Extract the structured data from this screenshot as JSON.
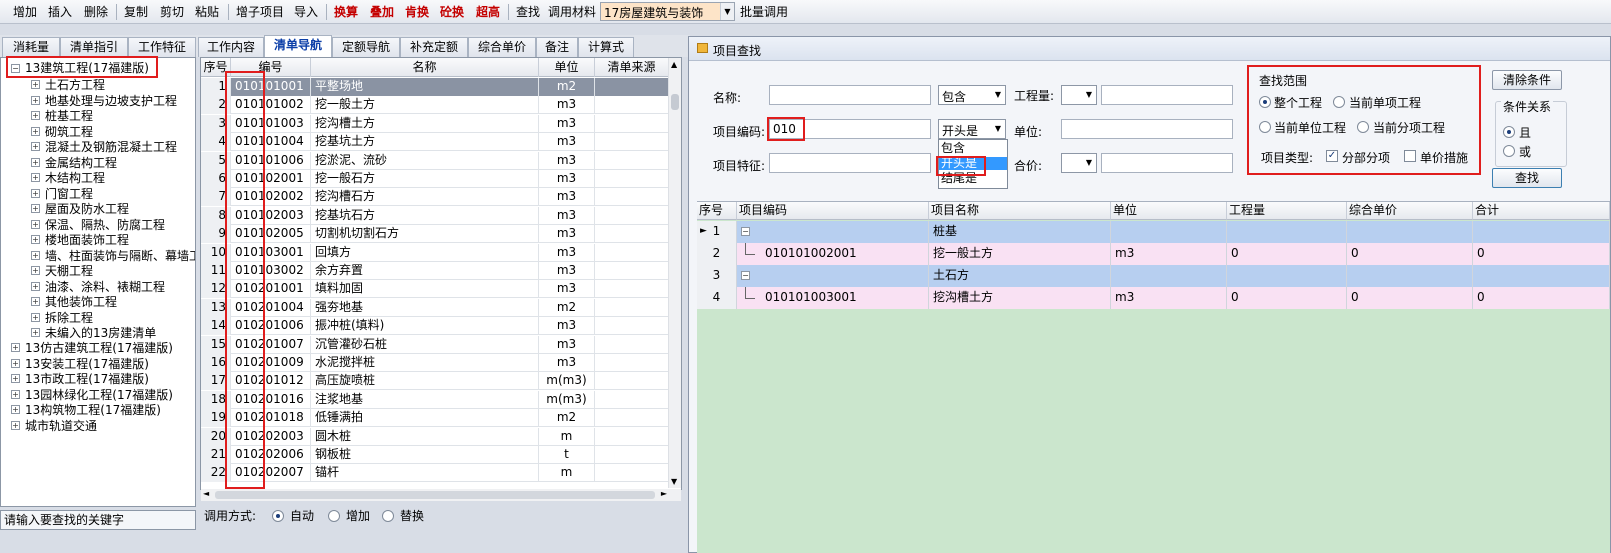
{
  "toolbar": {
    "items": [
      "增加",
      "插入",
      "删除",
      "复制",
      "剪切",
      "粘贴",
      "增子项目",
      "导入",
      "换算",
      "叠加",
      "肯换",
      "砼换",
      "超高",
      "查找",
      "调用材料",
      "批量调用"
    ],
    "combo_value": "17房屋建筑与装饰"
  },
  "tabs": [
    "消耗量",
    "清单指引",
    "工作特征",
    "工作内容",
    "清单导航",
    "定额导航",
    "补充定额",
    "综合单价",
    "备注",
    "计算式"
  ],
  "tree": {
    "root": "13建筑工程(17福建版)",
    "children": [
      "土石方工程",
      "地基处理与边坡支护工程",
      "桩基工程",
      "砌筑工程",
      "混凝土及钢筋混凝土工程",
      "金属结构工程",
      "木结构工程",
      "门窗工程",
      "屋面及防水工程",
      "保温、隔热、防腐工程",
      "楼地面装饰工程",
      "墙、柱面装饰与隔断、幕墙工",
      "天棚工程",
      "油漆、涂料、裱糊工程",
      "其他装饰工程",
      "拆除工程",
      "未编入的13房建清单"
    ],
    "others": [
      "13仿古建筑工程(17福建版)",
      "13安装工程(17福建版)",
      "13市政工程(17福建版)",
      "13园林绿化工程(17福建版)",
      "13构筑物工程(17福建版)",
      "城市轨道交通"
    ],
    "search_hint": "请输入要查找的关键字"
  },
  "grid": {
    "headers": [
      "序号",
      "编号",
      "名称",
      "单位",
      "清单来源"
    ],
    "rows": [
      [
        "1",
        "010101001",
        "平整场地",
        "m2"
      ],
      [
        "2",
        "010101002",
        "挖一般土方",
        "m3"
      ],
      [
        "3",
        "010101003",
        "挖沟槽土方",
        "m3"
      ],
      [
        "4",
        "010101004",
        "挖基坑土方",
        "m3"
      ],
      [
        "5",
        "010101006",
        "挖淤泥、流砂",
        "m3"
      ],
      [
        "6",
        "010102001",
        "挖一般石方",
        "m3"
      ],
      [
        "7",
        "010102002",
        "挖沟槽石方",
        "m3"
      ],
      [
        "8",
        "010102003",
        "挖基坑石方",
        "m3"
      ],
      [
        "9",
        "010102005",
        "切割机切割石方",
        "m3"
      ],
      [
        "10",
        "010103001",
        "回填方",
        "m3"
      ],
      [
        "11",
        "010103002",
        "余方弃置",
        "m3"
      ],
      [
        "12",
        "010201001",
        "填料加固",
        "m3"
      ],
      [
        "13",
        "010201004",
        "强夯地基",
        "m2"
      ],
      [
        "14",
        "010201006",
        "振冲桩(填料)",
        "m3"
      ],
      [
        "15",
        "010201007",
        "沉管灌砂石桩",
        "m3"
      ],
      [
        "16",
        "010201009",
        "水泥搅拌桩",
        "m3"
      ],
      [
        "17",
        "010201012",
        "高压旋喷桩",
        "m(m3)"
      ],
      [
        "18",
        "010201016",
        "注浆地基",
        "m(m3)"
      ],
      [
        "19",
        "010201018",
        "低锤满拍",
        "m2"
      ],
      [
        "20",
        "010202003",
        "圆木桩",
        "m"
      ],
      [
        "21",
        "010202006",
        "钢板桩",
        "t"
      ],
      [
        "22",
        "010202007",
        "锚杆",
        "m"
      ]
    ]
  },
  "callmode": {
    "label": "调用方式:",
    "options": [
      "自动",
      "增加",
      "替换"
    ],
    "selected": 0
  },
  "dialog": {
    "title": "项目查找",
    "name_label": "名称:",
    "name_mode": "包含",
    "qty_label": "工程量:",
    "code_label": "项目编码:",
    "code_value": "010",
    "code_mode": "开头是",
    "unit_label": "单位:",
    "feature_label": "项目特征:",
    "price_label": "合价:",
    "dropdown_options": [
      "包含",
      "开头是",
      "结尾是"
    ],
    "dropdown_selected": 1,
    "scope_title": "查找范围",
    "scope_options": [
      "整个工程",
      "当前单项工程",
      "当前单位工程",
      "当前分项工程"
    ],
    "scope_selected": 0,
    "type_label": "项目类型:",
    "type_options": [
      "分部分项",
      "单价措施"
    ],
    "type_checked": [
      true,
      false
    ],
    "clear_button": "清除条件",
    "relation_title": "条件关系",
    "relation_options": [
      "且",
      "或"
    ],
    "relation_selected": 0,
    "search_button": "查找",
    "result_headers": [
      "序号",
      "项目编码",
      "项目名称",
      "单位",
      "工程量",
      "综合单价",
      "合计"
    ],
    "result_rows": [
      {
        "no": "1",
        "code": "",
        "name": "桩基",
        "unit": "",
        "qty": "",
        "price": "",
        "total": "",
        "group": true
      },
      {
        "no": "2",
        "code": "010101002001",
        "name": "挖一般土方",
        "unit": "m3",
        "qty": "0",
        "price": "0",
        "total": "0",
        "group": false
      },
      {
        "no": "3",
        "code": "",
        "name": "土石方",
        "unit": "",
        "qty": "",
        "price": "",
        "total": "",
        "group": true
      },
      {
        "no": "4",
        "code": "010101003001",
        "name": "挖沟槽土方",
        "unit": "m3",
        "qty": "0",
        "price": "0",
        "total": "0",
        "group": false
      }
    ]
  },
  "colors": {
    "highlight": "#e01d1d",
    "active_tab": "#0c3fa8",
    "result_group_row": "#b7cff0",
    "result_item_row": "#f9e1f3",
    "result_bg": "#cbe6cd"
  }
}
